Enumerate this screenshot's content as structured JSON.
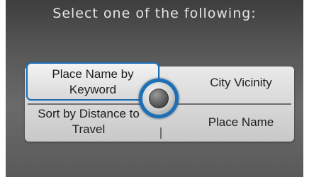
{
  "screen": {
    "title": "Select one of the following:"
  },
  "options": {
    "top_left": "Place Name by Keyword",
    "top_right": "City Vicinity",
    "bottom_left": "Sort by Distance to Travel",
    "bottom_right": "Place Name"
  },
  "selected_option": "Place Name by Keyword",
  "colors": {
    "selection_accent": "#1d6fb6"
  },
  "icons": {
    "center": "joystick-icon"
  }
}
